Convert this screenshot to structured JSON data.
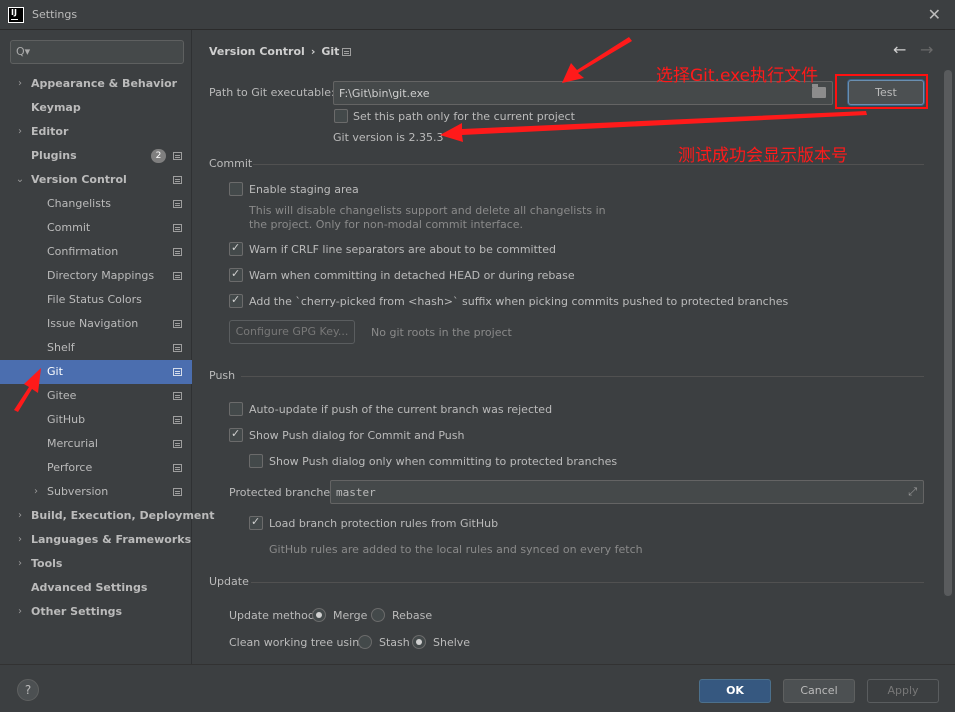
{
  "window": {
    "title": "Settings",
    "logo_text": "IJ",
    "close_glyph": "✕"
  },
  "sidebar": {
    "search_placeholder": "",
    "search_glyph": "Q▾",
    "items": [
      {
        "label": "Appearance & Behavior",
        "bold": true,
        "arrow": "›",
        "level": 0
      },
      {
        "label": "Keymap",
        "bold": true,
        "level": 0
      },
      {
        "label": "Editor",
        "bold": true,
        "arrow": "›",
        "level": 0
      },
      {
        "label": "Plugins",
        "bold": true,
        "level": 0,
        "badge": "2",
        "project_icon": true
      },
      {
        "label": "Version Control",
        "bold": true,
        "arrow": "⌄",
        "level": 0,
        "project_icon": true
      },
      {
        "label": "Changelists",
        "level": 1,
        "project_icon": true
      },
      {
        "label": "Commit",
        "level": 1,
        "project_icon": true
      },
      {
        "label": "Confirmation",
        "level": 1,
        "project_icon": true
      },
      {
        "label": "Directory Mappings",
        "level": 1,
        "project_icon": true
      },
      {
        "label": "File Status Colors",
        "level": 1
      },
      {
        "label": "Issue Navigation",
        "level": 1,
        "project_icon": true
      },
      {
        "label": "Shelf",
        "level": 1,
        "project_icon": true
      },
      {
        "label": "Git",
        "level": 1,
        "project_icon": true,
        "selected": true
      },
      {
        "label": "Gitee",
        "level": 1,
        "project_icon": true
      },
      {
        "label": "GitHub",
        "level": 1,
        "project_icon": true
      },
      {
        "label": "Mercurial",
        "level": 1,
        "project_icon": true
      },
      {
        "label": "Perforce",
        "level": 1,
        "project_icon": true
      },
      {
        "label": "Subversion",
        "level": 1,
        "arrow": "›",
        "project_icon": true
      },
      {
        "label": "Build, Execution, Deployment",
        "bold": true,
        "arrow": "›",
        "level": 0
      },
      {
        "label": "Languages & Frameworks",
        "bold": true,
        "arrow": "›",
        "level": 0
      },
      {
        "label": "Tools",
        "bold": true,
        "arrow": "›",
        "level": 0
      },
      {
        "label": "Advanced Settings",
        "bold": true,
        "level": 0
      },
      {
        "label": "Other Settings",
        "bold": true,
        "arrow": "›",
        "level": 0
      }
    ]
  },
  "header": {
    "breadcrumb_parent": "Version Control",
    "breadcrumb_sep": "›",
    "breadcrumb_current": "Git",
    "back_glyph": "←",
    "forward_glyph": "→"
  },
  "git_exe": {
    "label": "Path to Git executable:",
    "value": "F:\\Git\\bin\\git.exe",
    "test_button": "Test",
    "current_project_only": "Set this path only for the current project",
    "current_project_only_checked": false,
    "version_text": "Git version is 2.35.3"
  },
  "commit": {
    "section_title": "Commit",
    "staging_label": "Enable staging area",
    "staging_checked": false,
    "staging_help_line1": "This will disable changelists support and delete all changelists in",
    "staging_help_line2": "the project. Only for non-modal commit interface.",
    "crlf_label": "Warn if CRLF line separators are about to be committed",
    "crlf_checked": true,
    "detached_label": "Warn when committing in detached HEAD or during rebase",
    "detached_checked": true,
    "cherry_label": "Add the `cherry-picked from <hash>` suffix when picking commits pushed to protected branches",
    "cherry_checked": true,
    "gpg_button": "Configure GPG Key...",
    "gpg_note": "No git roots in the project"
  },
  "push": {
    "section_title": "Push",
    "auto_update_label": "Auto-update if push of the current branch was rejected",
    "auto_update_checked": false,
    "show_dialog_label": "Show Push dialog for Commit and Push",
    "show_dialog_checked": true,
    "protected_only_label": "Show Push dialog only when committing to protected branches",
    "protected_only_checked": false,
    "protected_branches_label": "Protected branches:",
    "protected_branches_value": "master",
    "load_rules_label": "Load branch protection rules from GitHub",
    "load_rules_checked": true,
    "load_rules_help": "GitHub rules are added to the local rules and synced on every fetch"
  },
  "update": {
    "section_title": "Update",
    "method_label": "Update method:",
    "method_options": [
      "Merge",
      "Rebase"
    ],
    "method_selected": "Merge",
    "clean_label": "Clean working tree using:",
    "clean_options": [
      "Stash",
      "Shelve"
    ],
    "clean_selected": "Shelve"
  },
  "footer": {
    "help": "?",
    "ok": "OK",
    "cancel": "Cancel",
    "apply": "Apply"
  },
  "annotations": {
    "select_exe": "选择Git.exe执行文件",
    "test_success": "测试成功会显示版本号",
    "color": "#ff1a1a"
  }
}
